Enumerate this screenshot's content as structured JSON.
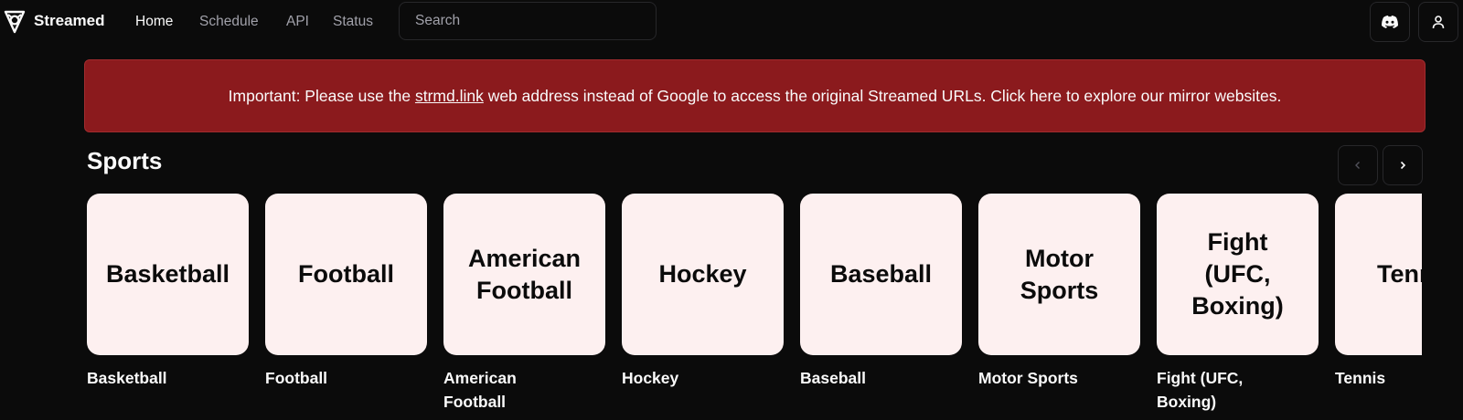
{
  "header": {
    "brand": "Streamed",
    "nav": [
      {
        "label": "Home",
        "active": true
      },
      {
        "label": "Schedule",
        "active": false
      },
      {
        "label": "API",
        "active": false
      },
      {
        "label": "Status",
        "active": false
      }
    ],
    "search": {
      "placeholder": "Search",
      "value": ""
    },
    "icons": [
      "discord-icon",
      "user-icon"
    ]
  },
  "banner": {
    "prefix": "Important: Please use the ",
    "link": "strmd.link",
    "suffix": " web address instead of Google to access the original Streamed URLs. Click here to explore our mirror websites."
  },
  "sports": {
    "title": "Sports",
    "items": [
      {
        "tile": "Basketball",
        "label": "Basketball"
      },
      {
        "tile": "Football",
        "label": "Football"
      },
      {
        "tile": "American Football",
        "label": "American Football"
      },
      {
        "tile": "Hockey",
        "label": "Hockey"
      },
      {
        "tile": "Baseball",
        "label": "Baseball"
      },
      {
        "tile": "Motor Sports",
        "label": "Motor Sports"
      },
      {
        "tile": "Fight (UFC, Boxing)",
        "label": "Fight (UFC, Boxing)"
      },
      {
        "tile": "Tennis",
        "label": "Tennis"
      }
    ]
  },
  "colors": {
    "background": "#0b0b0b",
    "banner": "#8b1a1d",
    "tile": "#fdf0f0",
    "muted_text": "#a1a1aa"
  }
}
